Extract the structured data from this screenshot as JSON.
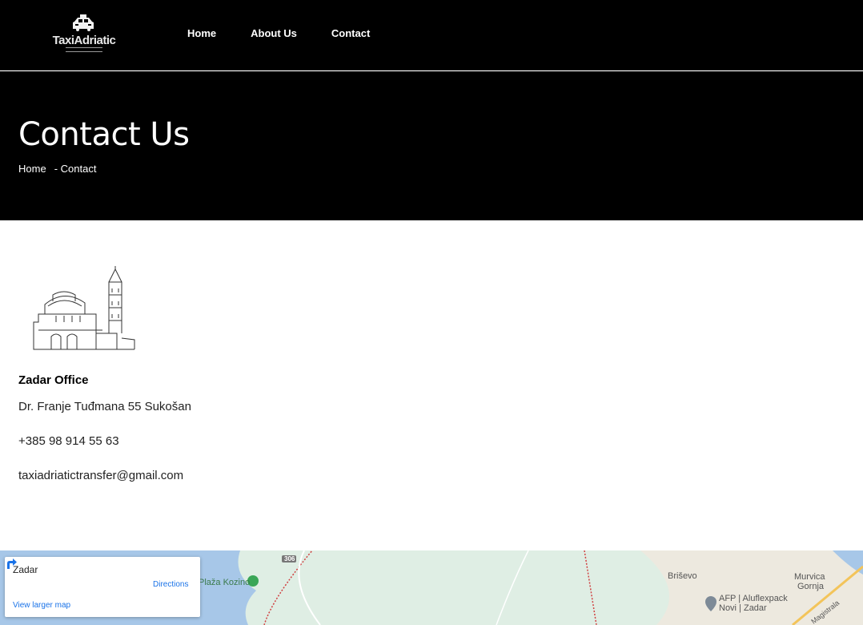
{
  "header": {
    "logo_text": "TaxiAdriatic",
    "nav": [
      {
        "label": "Home"
      },
      {
        "label": "About Us"
      },
      {
        "label": "Contact"
      }
    ]
  },
  "hero": {
    "title": "Contact Us",
    "breadcrumb_home": "Home",
    "breadcrumb_current": "- Contact"
  },
  "office": {
    "title": "Zadar Office",
    "address": "Dr. Franje Tuđmana 55 Sukošan",
    "phone": "+385 98 914 55 63",
    "email": "taxiadriatictransfer@gmail.com"
  },
  "map": {
    "place_name": "Zadar",
    "directions_label": "Directions",
    "larger_map_label": "View larger map",
    "road_number": "306",
    "labels": {
      "beach": "Plaža Kozino",
      "village1": "Briševo",
      "village2_line1": "Murvica",
      "village2_line2": "Gornja",
      "business_line1": "AFP | Aluflexpack",
      "business_line2": "Novi | Zadar",
      "road": "Magistrala"
    },
    "colors": {
      "water": "#a7c7e8",
      "land": "#dfeee4",
      "urban": "#ede9df",
      "accent": "#1a73e8"
    }
  },
  "icons": {
    "taxi": "taxi-car-icon",
    "directions": "directions-icon",
    "pin": "map-pin-icon"
  }
}
